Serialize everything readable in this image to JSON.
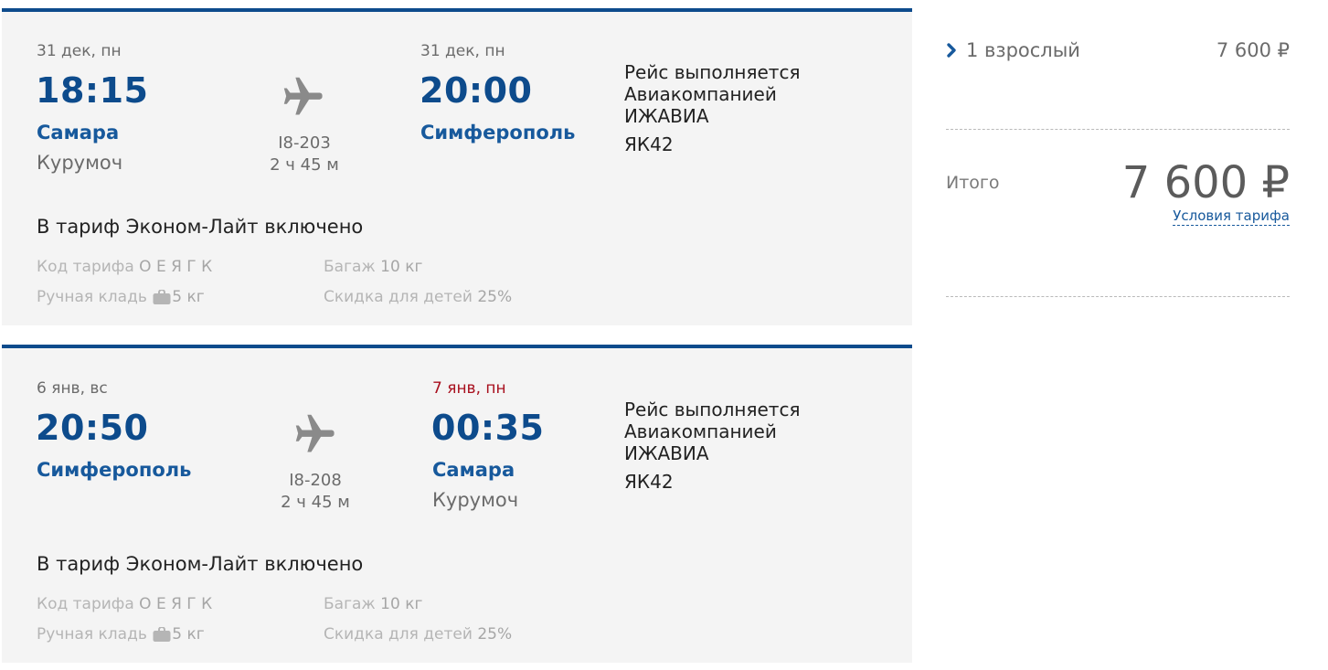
{
  "flights": [
    {
      "dep_date": "31 дек, пн",
      "dep_time": "18:15",
      "dep_city": "Самара",
      "dep_airport": "Курумоч",
      "flight_no": "I8-203",
      "duration": "2 ч 45 м",
      "arr_date": "31 дек, пн",
      "arr_time": "20:00",
      "arr_city": "Симферополь",
      "arr_airport": "",
      "carrier_line1": "Рейс выполняется",
      "carrier_line2": "Авиакомпанией",
      "carrier_line3": "ИЖАВИА",
      "aircraft": "ЯК42",
      "tariff_title": "В тариф Эконом-Лайт включено",
      "fare_code_label": "Код тарифа",
      "fare_code_value": "О Е Я Г К",
      "baggage_label": "Багаж",
      "baggage_value": "10 кг",
      "hand_label": "Ручная кладь",
      "hand_value": "5 кг",
      "child_label": "Скидка для детей",
      "child_value": "25%"
    },
    {
      "dep_date": "6 янв, вс",
      "dep_time": "20:50",
      "dep_city": "Симферополь",
      "dep_airport": "",
      "flight_no": "I8-208",
      "duration": "2 ч 45 м",
      "arr_date": "7 янв, пн",
      "arr_time": "00:35",
      "arr_city": "Самара",
      "arr_airport": "Курумоч",
      "carrier_line1": "Рейс выполняется",
      "carrier_line2": "Авиакомпанией",
      "carrier_line3": "ИЖАВИА",
      "aircraft": "ЯК42",
      "tariff_title": "В тариф Эконом-Лайт включено",
      "fare_code_label": "Код тарифа",
      "fare_code_value": "О Е Я Г К",
      "baggage_label": "Багаж",
      "baggage_value": "10 кг",
      "hand_label": "Ручная кладь",
      "hand_value": "5 кг",
      "child_label": "Скидка для детей",
      "child_value": "25%"
    }
  ],
  "summary": {
    "passengers": "1 взрослый",
    "passengers_price": "7 600 ₽",
    "total_label": "Итого",
    "total_price": "7 600 ₽",
    "fare_conditions": "Условия тарифа"
  },
  "icons": {
    "plane": "airplane-icon",
    "bag": "bag-icon",
    "chevron": "chevron-right-icon"
  },
  "colors": {
    "accent": "#0d4b8c",
    "link": "#17599c",
    "next_day": "#a8101e",
    "card_bg": "#f4f4f4"
  }
}
